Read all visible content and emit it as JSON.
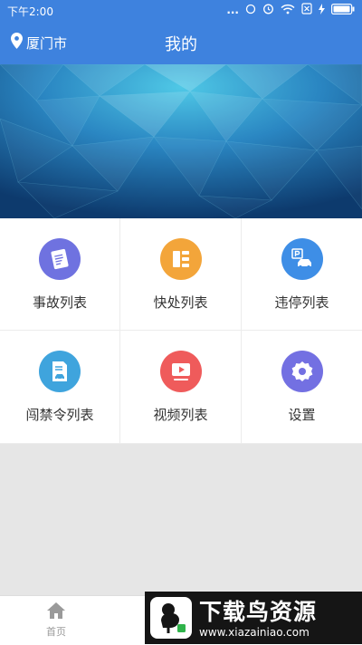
{
  "status_bar": {
    "time": "下午2:00",
    "dots": "...",
    "colors": {
      "bg": "#3e82de"
    }
  },
  "app_bar": {
    "location": "厦门市",
    "title": "我的"
  },
  "banner": {
    "colors": {
      "top": "#1e5fa6",
      "mid": "#2e9dc8",
      "bottom": "#0e3b6e"
    }
  },
  "menu": {
    "items": [
      {
        "label": "事故列表",
        "icon": "accident-list-icon",
        "color": "#6f72e0"
      },
      {
        "label": "快处列表",
        "icon": "quick-handle-list-icon",
        "color": "#f3a53a"
      },
      {
        "label": "违停列表",
        "icon": "parking-violation-icon",
        "color": "#3e8ee6"
      },
      {
        "label": "闯禁令列表",
        "icon": "restriction-violation-icon",
        "color": "#3fa4dd"
      },
      {
        "label": "视频列表",
        "icon": "video-list-icon",
        "color": "#ef5b5b"
      },
      {
        "label": "设置",
        "icon": "settings-gear-icon",
        "color": "#7370e2"
      }
    ]
  },
  "tab_bar": {
    "home_label": "首页"
  },
  "watermark": {
    "title": "下载鸟资源",
    "url": "www.xiazainiao.com"
  }
}
